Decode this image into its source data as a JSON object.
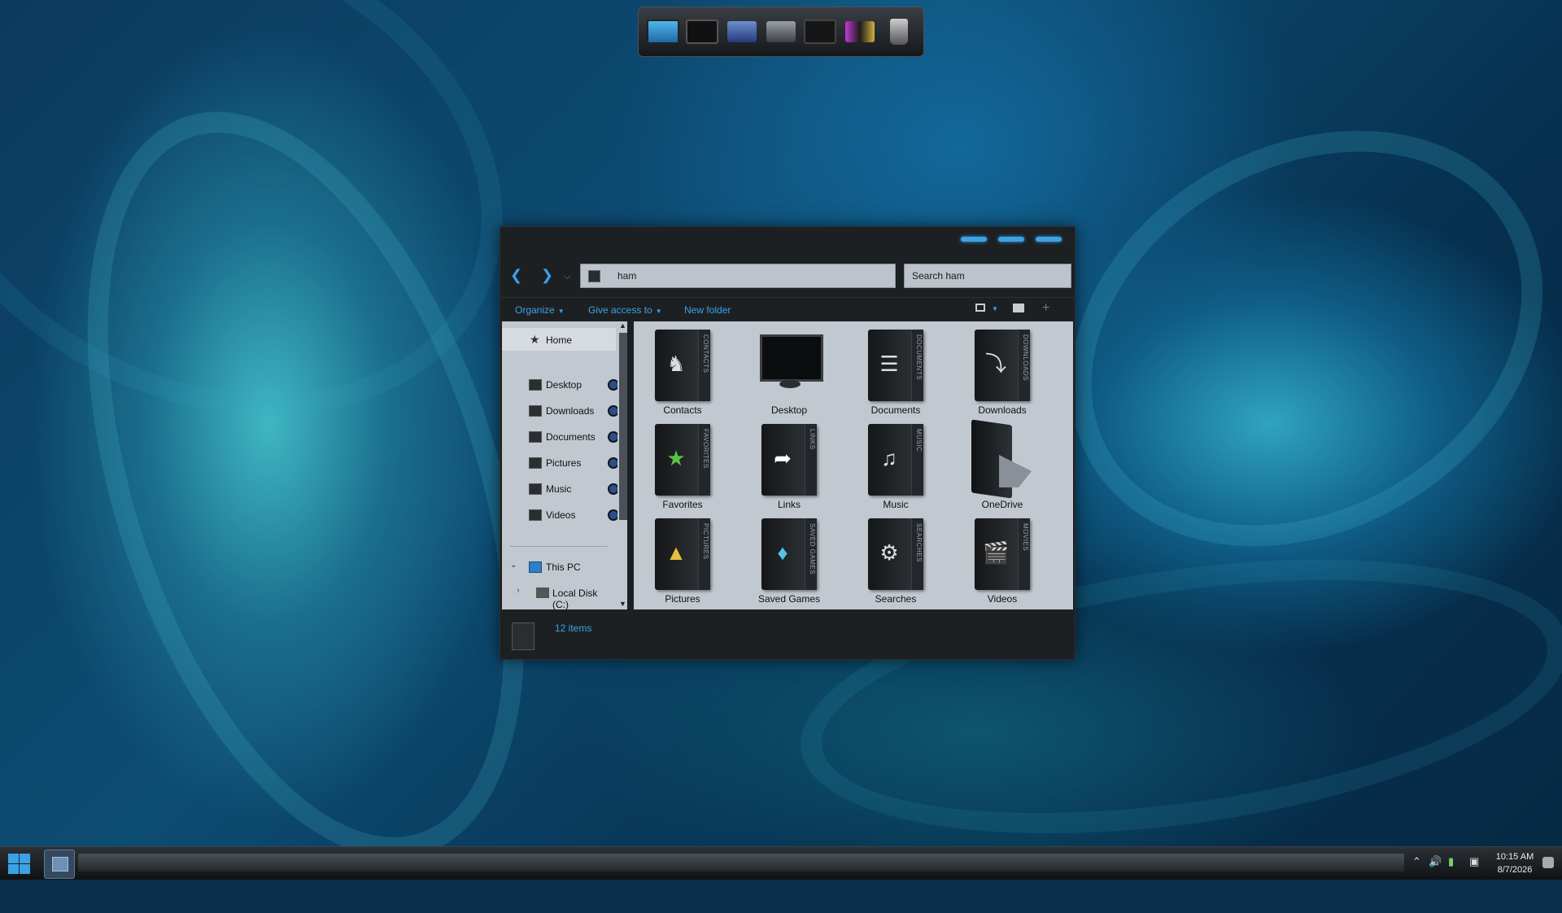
{
  "address": {
    "path": "ham"
  },
  "search": {
    "placeholder": "Search ham"
  },
  "commands": {
    "organize": "Organize",
    "give_access": "Give access to",
    "new_folder": "New folder"
  },
  "sidebar": {
    "home": "Home",
    "quick_access": [
      "Desktop",
      "Downloads",
      "Documents",
      "Pictures",
      "Music",
      "Videos"
    ],
    "this_pc": "This PC",
    "local_disk": "Local Disk (C:)"
  },
  "items": [
    {
      "name": "Contacts",
      "spine": "CONTACTS",
      "icon": "contacts-icon"
    },
    {
      "name": "Desktop",
      "spine": "",
      "icon": "monitor-icon"
    },
    {
      "name": "Documents",
      "spine": "DOCUMENTS",
      "icon": "documents-icon"
    },
    {
      "name": "Downloads",
      "spine": "DOWNLOADS",
      "icon": "download-arrow-icon"
    },
    {
      "name": "Favorites",
      "spine": "FAVORITES",
      "icon": "star-icon"
    },
    {
      "name": "Links",
      "spine": "LINKS",
      "icon": "link-arrow-icon"
    },
    {
      "name": "Music",
      "spine": "MUSIC",
      "icon": "music-icon"
    },
    {
      "name": "OneDrive",
      "spine": "",
      "icon": "onedrive-folder-icon"
    },
    {
      "name": "Pictures",
      "spine": "PICTURES",
      "icon": "pictures-icon"
    },
    {
      "name": "Saved Games",
      "spine": "SAVED GAMES",
      "icon": "game-icon"
    },
    {
      "name": "Searches",
      "spine": "SEARCHES",
      "icon": "search-gears-icon"
    },
    {
      "name": "Videos",
      "spine": "MOVIES",
      "icon": "film-icon"
    }
  ],
  "status": {
    "count": "12 items"
  },
  "taskbar": {
    "time": "10:15 AM",
    "date": "8/7/2026"
  },
  "colors": {
    "accent": "#3aa3e6",
    "pane": "#c1c8cf",
    "window": "#1d2023"
  }
}
